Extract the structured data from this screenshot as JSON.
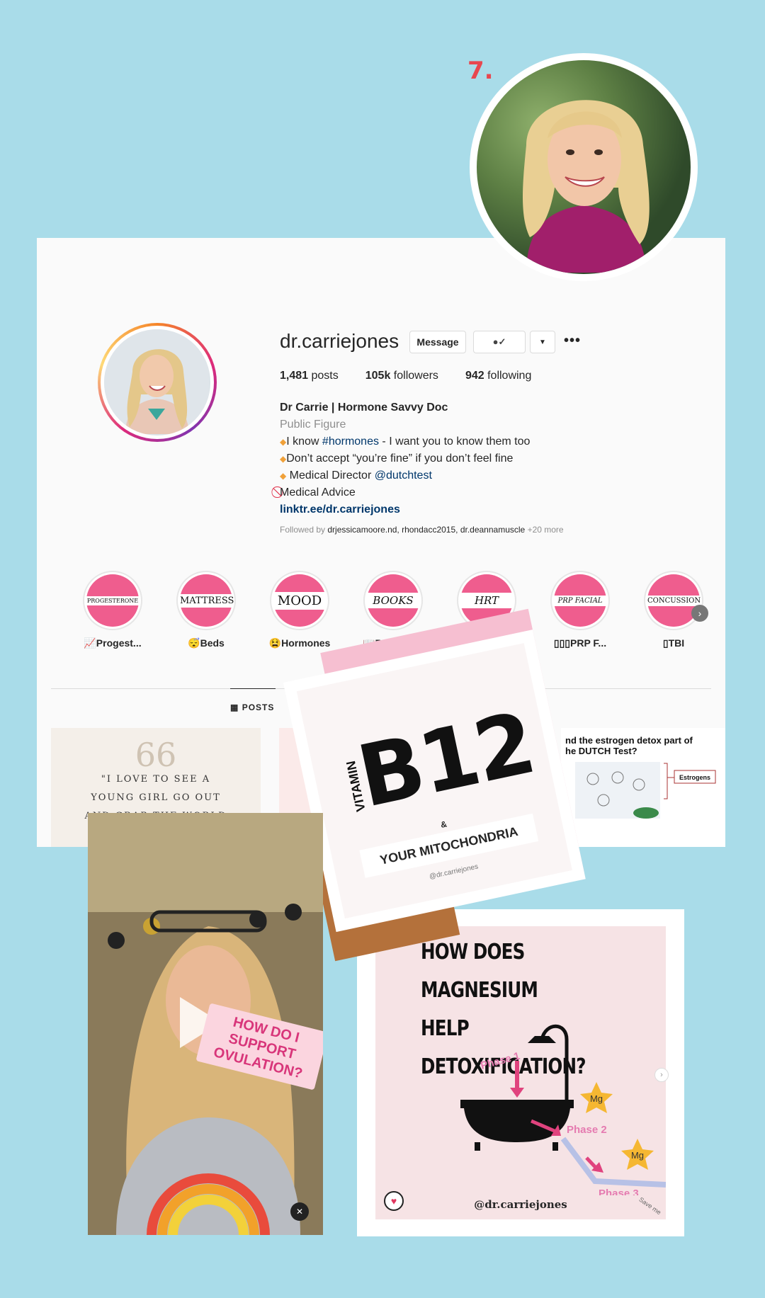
{
  "page_number": "7.",
  "profile": {
    "username": "dr.carriejones",
    "message_button": "Message",
    "posts_count": "1,481",
    "posts_label": "posts",
    "followers_count": "105k",
    "followers_label": "followers",
    "following_count": "942",
    "following_label": "following",
    "display_name": "Dr Carrie | Hormone Savvy Doc",
    "category": "Public Figure",
    "bio_line1_pre": "I know ",
    "bio_line1_tag": "#hormones",
    "bio_line1_post": " - I want you to know them too",
    "bio_line2": "Don’t accept “you’re fine” if you don’t feel fine",
    "bio_line3_pre": " Medical Director ",
    "bio_line3_mention": "@dutchtest",
    "bio_line4": "Medical Advice",
    "link": "linktr.ee/dr.carriejones",
    "followed_by_label": "Followed by",
    "followed_by_names": "drjessicamoore.nd, rhondacc2015, dr.deannamuscle",
    "followed_more": "+20 more"
  },
  "highlights": [
    {
      "band": "PROGESTERONE",
      "label": "📈Progest..."
    },
    {
      "band": "MATTRESS",
      "label": "😴Beds"
    },
    {
      "band": "MOOD",
      "label": "😫Hormones"
    },
    {
      "band": "BOOKS",
      "label": "📖Book Rec."
    },
    {
      "band": "HRT",
      "label": ""
    },
    {
      "band": "PRP FACIAL",
      "label": "▯▯▯PRP F..."
    },
    {
      "band": "CONCUSSION",
      "label": "▯TBI"
    }
  ],
  "tabs": {
    "posts": "POSTS"
  },
  "posts": {
    "quote_mark": "66",
    "quote_l1": "\"I LOVE TO SEE A",
    "quote_l2": "YOUNG GIRL GO OUT",
    "quote_l3": "AND GRAB THE WORLD",
    "dutch_q1": "nd the estrogen detox part of",
    "dutch_q2": "he DUTCH Test?",
    "dutch_label": "Estrogens"
  },
  "b12": {
    "vitamin": "VITAMIN",
    "title": "B12",
    "amp": "&",
    "subtitle": "YOUR MITOCHONDRIA",
    "handle": "@dr.carriejones"
  },
  "video": {
    "overlay_l1": "HOW DO I SUPPORT",
    "overlay_l2": "OVULATION?"
  },
  "magnesium": {
    "title_l1": "HOW DOES MAGNESIUM",
    "title_l2": "HELP DETOXIFICATION?",
    "phase1": "Phase 1",
    "phase2": "Phase 2",
    "phase3": "Phase 3",
    "mg": "Mg",
    "handle": "@dr.carriejones",
    "save": "Save me"
  },
  "colors": {
    "background": "#a9dce9",
    "highlight_pink": "#ef5d8e",
    "accent_red": "#e8474f"
  }
}
